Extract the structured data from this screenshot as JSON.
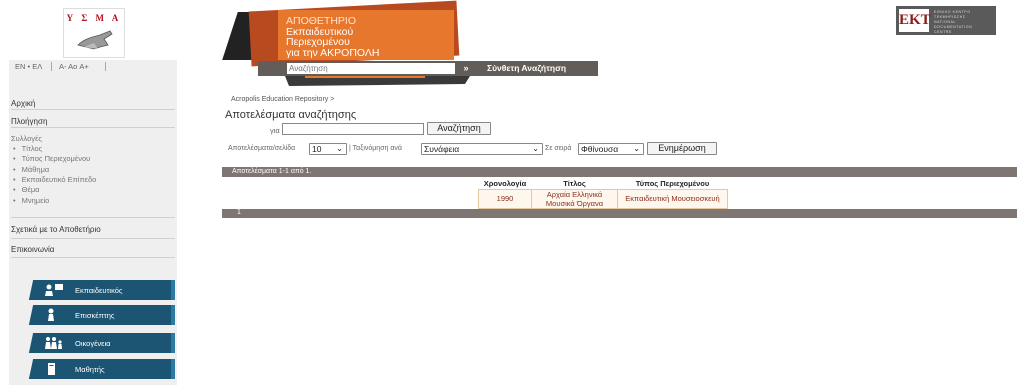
{
  "header": {
    "ysma_logo_text": "Υ Σ Μ Α",
    "banner_lines": [
      "ΑΠΟΘΕΤΗΡΙΟ",
      "Εκπαιδευτικού",
      "Περιεχομένου",
      "για την ΑΚΡΟΠΟΛΗ"
    ],
    "ekt_logo_text": "EKT",
    "ekt_side_lines": [
      "ΕΘΝΙΚΟ ΚΕΝΤΡΟ",
      "ΤΕΚΜΗΡΙΩΣΗΣ",
      "NATIONAL",
      "DOCUMENTATION",
      "CENTRE"
    ]
  },
  "langbar": {
    "language": "EN • ΕΛ",
    "font_sizes": "A- Aο A+"
  },
  "search_bar": {
    "placeholder": "Αναζήτηση",
    "go_label": "»",
    "advanced_label": "Σύνθετη Αναζήτηση"
  },
  "sidebar": {
    "home": "Αρχική",
    "browse": "Πλοήγηση",
    "collections": "Συλλογές",
    "sub_items": [
      "Τίτλος",
      "Τύπος Περιεχομένου",
      "Μάθημα",
      "Εκπαιδευτικό Επίπεδο",
      "Θέμα",
      "Μνημείο"
    ],
    "about": "Σχετικά με το Αποθετήριο",
    "contact": "Επικοινωνία",
    "profiles": [
      {
        "label": "Εκπαιδευτικός",
        "icon": "teacher-icon"
      },
      {
        "label": "Επισκέπτης",
        "icon": "visitor-icon"
      },
      {
        "label": "Οικογένεια",
        "icon": "family-icon"
      },
      {
        "label": "Μαθητής",
        "icon": "student-icon"
      }
    ]
  },
  "main": {
    "breadcrumb": "Acropolis Education Repository >",
    "title": "Αποτελέσματα αναζήτησης",
    "query_label": "για",
    "query_value": "",
    "search_button": "Αναζήτηση",
    "per_page_label": "Αποτελέσματα/σελίδα",
    "per_page_value": "10",
    "sort_label": "| Ταξινόμηση ανά",
    "sort_value": "Συνάφεια",
    "order_label": "Σε σειρά",
    "order_value": "Φθίνουσα",
    "update_button": "Ενημέρωση",
    "results_summary": "Αποτελέσματα 1-1 από 1.",
    "pagination_page": "1",
    "table": {
      "headers": [
        "Χρονολογία",
        "Τίτλος",
        "Τύπος Περιεχομένου"
      ],
      "rows": [
        [
          "1990",
          "Αρχαία Ελληνικά Μουσικά Όργανα",
          "Εκπαιδευτική Μουσειοσκευή"
        ]
      ]
    }
  }
}
